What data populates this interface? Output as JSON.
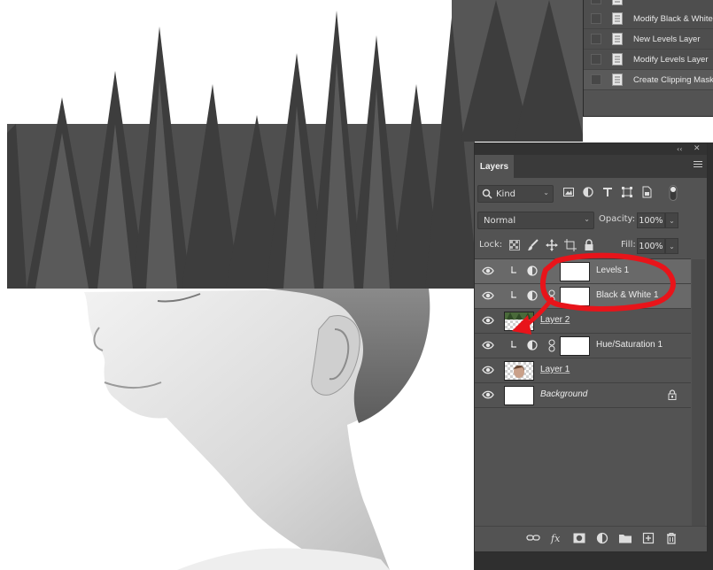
{
  "history": {
    "items": [
      {
        "label": ""
      },
      {
        "label": "Modify Black & White Layer"
      },
      {
        "label": "New Levels Layer"
      },
      {
        "label": "Modify Levels Layer"
      },
      {
        "label": "Create Clipping Mask"
      }
    ]
  },
  "panel": {
    "tab_label": "Layers",
    "filter_kind": "Kind",
    "blend_mode": "Normal",
    "opacity_label": "Opacity:",
    "opacity_value": "100%",
    "lock_label": "Lock:",
    "fill_label": "Fill:",
    "fill_value": "100%"
  },
  "layers": [
    {
      "name": "Levels 1",
      "type": "adjustment",
      "clipped": true,
      "selected": true
    },
    {
      "name": "Black & White 1",
      "type": "adjustment",
      "clipped": true,
      "selected": true
    },
    {
      "name": "Layer 2",
      "type": "pixel",
      "clipped": false,
      "selected": false
    },
    {
      "name": "Hue/Saturation 1",
      "type": "adjustment",
      "clipped": true,
      "selected": false
    },
    {
      "name": "Layer 1",
      "type": "pixel",
      "clipped": false,
      "selected": false
    },
    {
      "name": "Background",
      "type": "background",
      "clipped": false,
      "selected": false,
      "locked": true
    }
  ],
  "colors": {
    "panel_bg": "#535353",
    "selected_row": "#696969",
    "annotation_red": "#e8141a"
  }
}
